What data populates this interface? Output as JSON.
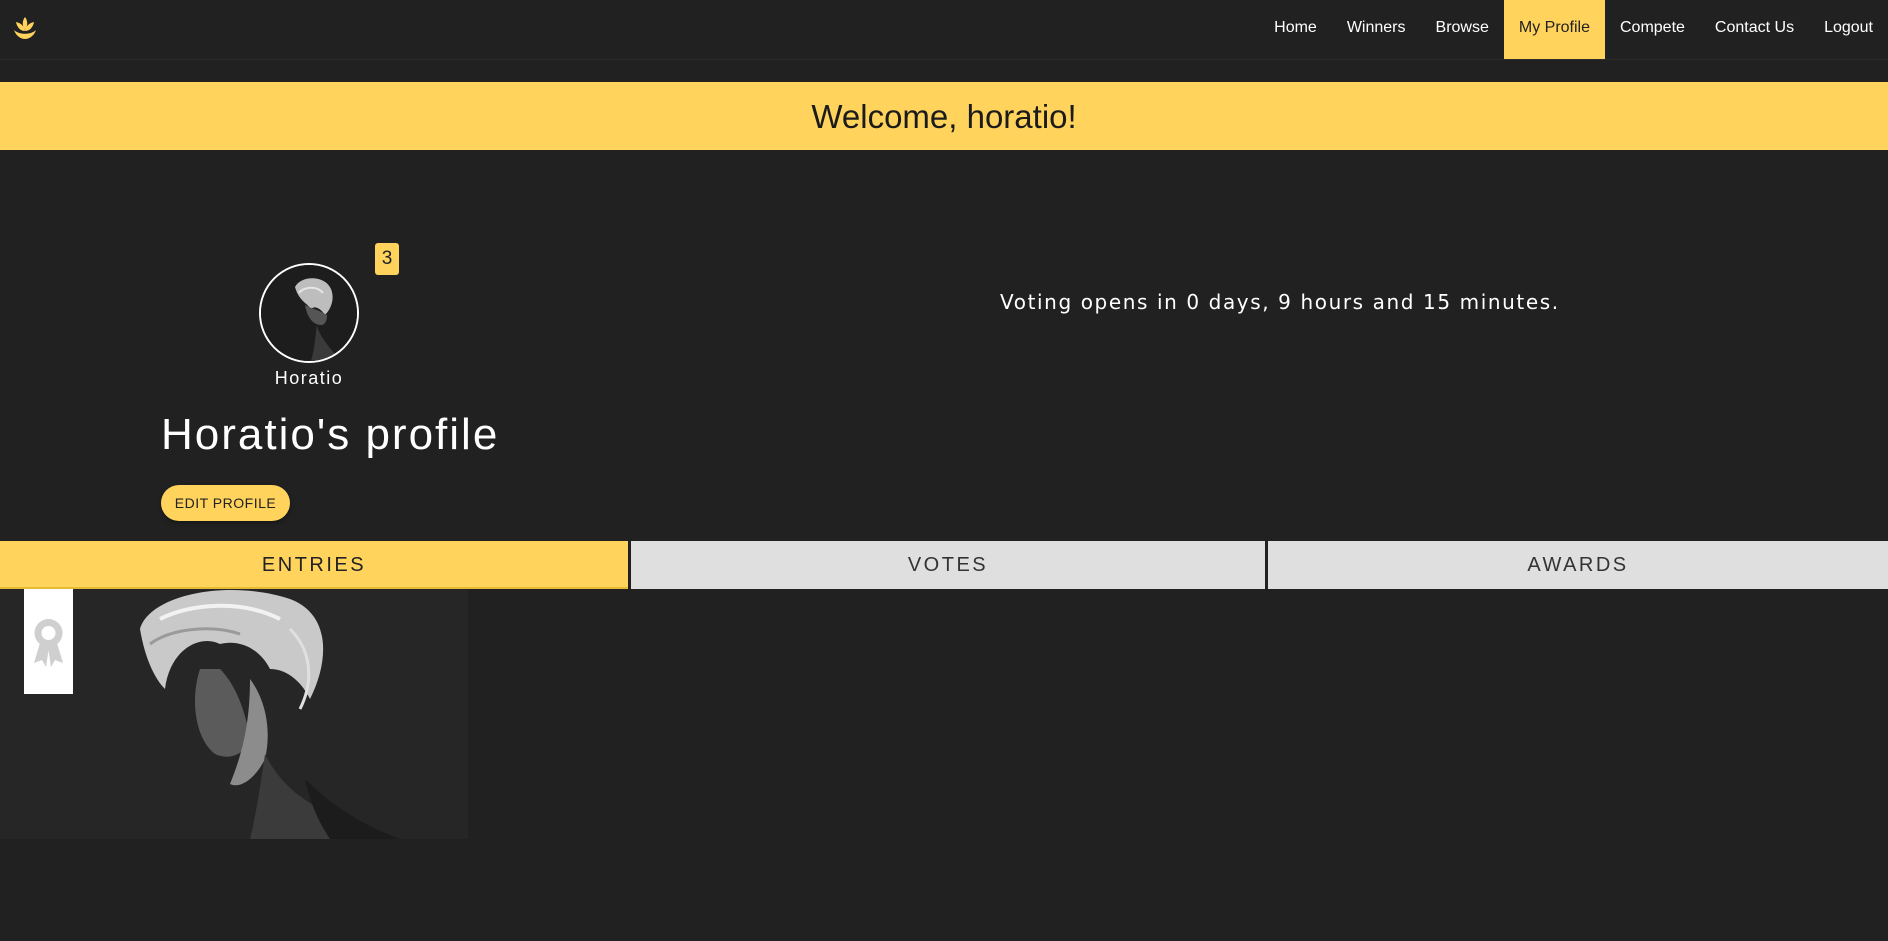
{
  "nav": {
    "items": [
      {
        "label": "Home"
      },
      {
        "label": "Winners"
      },
      {
        "label": "Browse"
      },
      {
        "label": "My Profile",
        "active": true
      },
      {
        "label": "Compete"
      },
      {
        "label": "Contact Us"
      },
      {
        "label": "Logout"
      }
    ],
    "logo_icon": "lotus-icon"
  },
  "banner": {
    "welcome": "Welcome, horatio!"
  },
  "profile": {
    "badge_count": "3",
    "avatar_name": "Horatio",
    "title": "Horatio's profile",
    "edit_label": "EDIT PROFILE"
  },
  "voting": {
    "message": "Voting opens in 0 days, 9 hours and 15 minutes."
  },
  "tabs": [
    {
      "label": "ENTRIES",
      "active": true
    },
    {
      "label": "VOTES"
    },
    {
      "label": "AWARDS"
    }
  ],
  "colors": {
    "accent": "#ffd35c",
    "background": "#212121",
    "tab_inactive": "#dfdfdf"
  }
}
